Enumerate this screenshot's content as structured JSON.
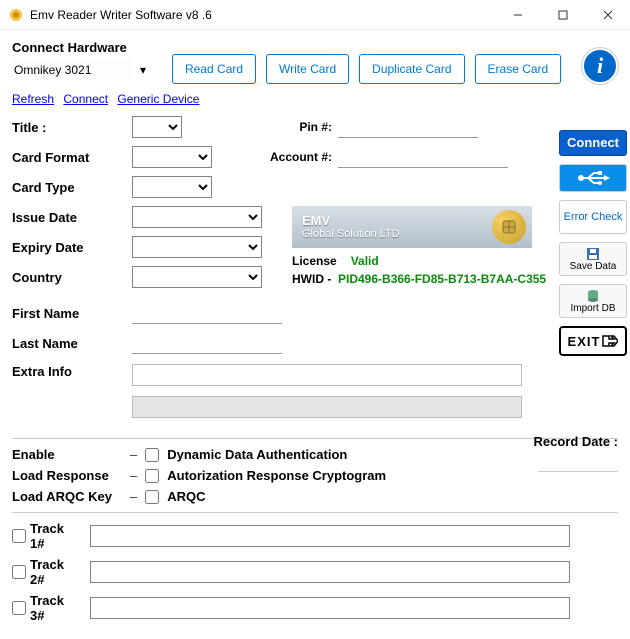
{
  "window": {
    "title": "Emv Reader Writer Software v8 .6"
  },
  "hardware": {
    "label": "Connect Hardware",
    "selected": "Omnikey 3021"
  },
  "topbuttons": {
    "read": "Read Card",
    "write": "Write Card",
    "duplicate": "Duplicate Card",
    "erase": "Erase Card"
  },
  "links": {
    "refresh": "Refresh",
    "connect": "Connect",
    "generic": "Generic Device"
  },
  "fields": {
    "title": "Title :",
    "pin": "Pin #:",
    "cardformat": "Card Format",
    "account": "Account #:",
    "cardtype": "Card Type",
    "issuedate": "Issue Date",
    "expirydate": "Expiry Date",
    "country": "Country",
    "firstname": "First Name",
    "lastname": "Last Name",
    "extrainfo": "Extra Info"
  },
  "right": {
    "connect": "Connect",
    "errorcheck": "Error Check",
    "savedata": "Save Data",
    "importdb": "Import DB",
    "exit": "EXIT"
  },
  "banner": {
    "line1": "EMV",
    "line2": "Global Solution LTD"
  },
  "license": {
    "label": "License",
    "status": "Valid",
    "hwid_label": "HWID  -",
    "hwid": "PID496-B366-FD85-B713-B7AA-C355"
  },
  "options": {
    "enable": "Enable",
    "dda": "Dynamic Data Authentication",
    "loadresp": "Load Response",
    "arc": "Autorization Response Cryptogram",
    "loadarqc": "Load ARQC Key",
    "arqc": "ARQC"
  },
  "tracks": {
    "t1": "Track 1#",
    "t2": "Track 2#",
    "t3": "Track 3#"
  },
  "recorddate": "Record Date :"
}
